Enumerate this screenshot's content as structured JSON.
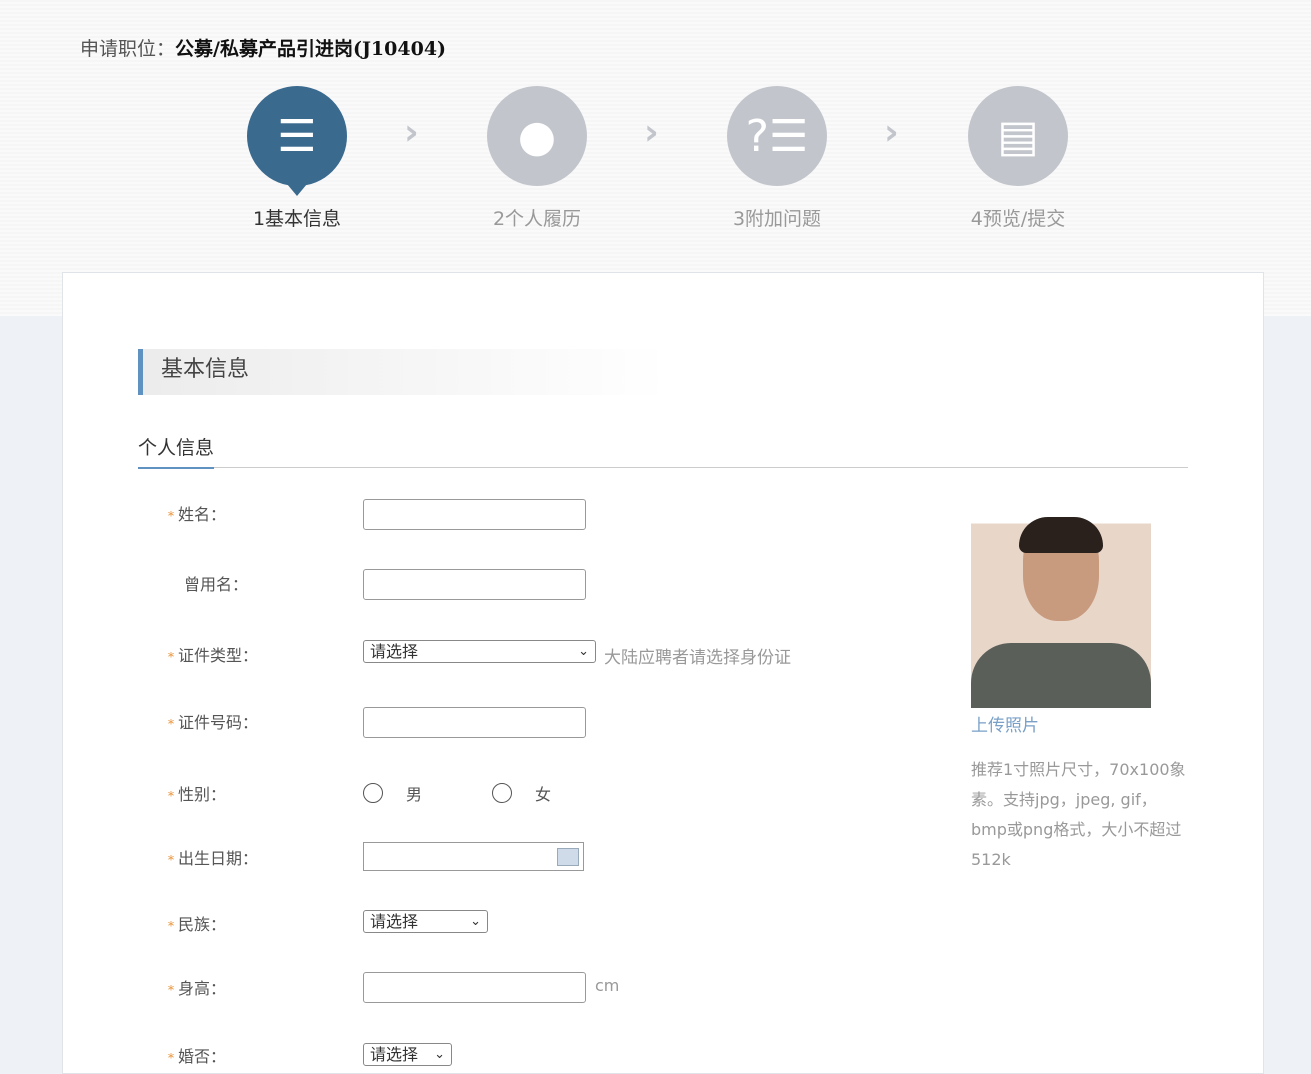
{
  "header": {
    "job_label": "申请职位：",
    "job_title": "公募/私募产品引进岗(J10404)"
  },
  "steps": [
    {
      "label": "1基本信息",
      "icon": "person-card-icon"
    },
    {
      "label": "2个人履历",
      "icon": "ribbon-icon"
    },
    {
      "label": "3附加问题",
      "icon": "question-list-icon"
    },
    {
      "label": "4预览/提交",
      "icon": "document-icon"
    }
  ],
  "section": {
    "title": "基本信息",
    "subtitle": "个人信息"
  },
  "fields": {
    "name": "姓名：",
    "former_name": "曾用名：",
    "id_type": "证件类型：",
    "id_type_value": "请选择",
    "id_type_hint": "大陆应聘者请选择身份证",
    "id_number": "证件号码：",
    "gender": "性别：",
    "male": "男",
    "female": "女",
    "birth": "出生日期：",
    "ethnicity": "民族：",
    "ethnicity_value": "请选择",
    "height": "身高：",
    "height_unit": "cm",
    "marital": "婚否：",
    "marital_value": "请选择"
  },
  "photo": {
    "upload": "上传照片",
    "note": "推荐1寸照片尺寸，70x100象素。支持jpg，jpeg, gif，bmp或png格式，大小不超过512k"
  }
}
